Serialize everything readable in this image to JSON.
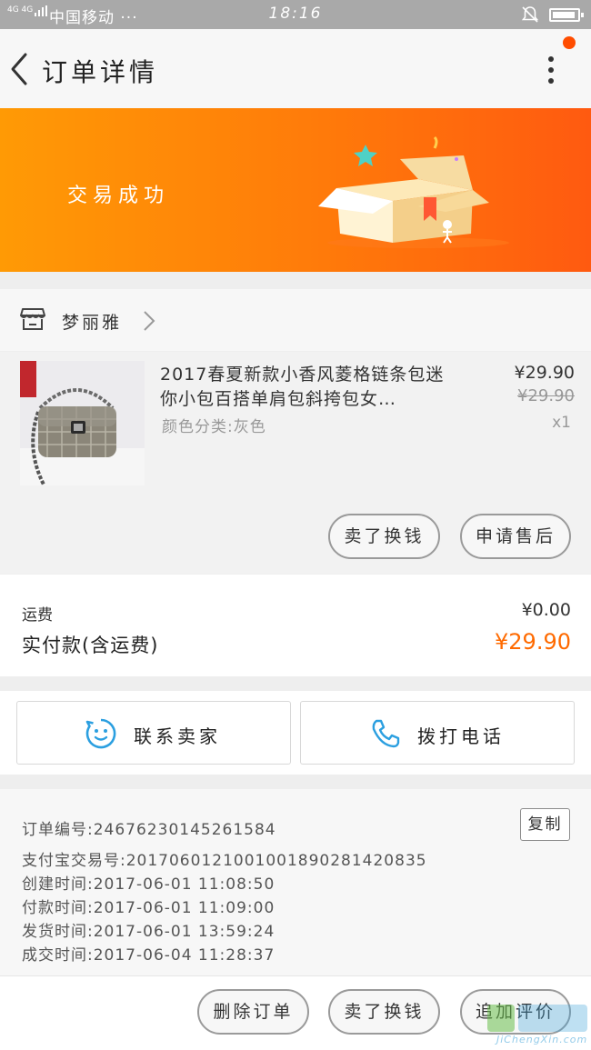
{
  "status_bar": {
    "signal": "4G 4G",
    "carrier": "中国移动 ···",
    "time": "18:16"
  },
  "header": {
    "title": "订单详情"
  },
  "banner": {
    "status": "交易成功"
  },
  "shop": {
    "name": "梦丽雅"
  },
  "item": {
    "title": "2017春夏新款小香风菱格链条包迷你小包百搭单肩包斜挎包女…",
    "variant": "颜色分类:灰色",
    "price": "¥29.90",
    "original_price": "¥29.90",
    "quantity": "x1",
    "buttons": [
      "卖了换钱",
      "申请售后"
    ]
  },
  "cost": {
    "shipping_label": "运费",
    "shipping_value": "¥0.00",
    "paid_label": "实付款(含运费)",
    "paid_value": "¥29.90"
  },
  "contact": {
    "seller_label": "联系卖家",
    "call_label": "拨打电话"
  },
  "order_info": {
    "order_no": "订单编号:2467623014526158​4",
    "copy_label": "复制",
    "alipay_no": "支付宝交易号:2017060121001001890281420835",
    "created": "创建时间:2017-06-01 11:08:50",
    "paid": "付款时间:2017-06-01 11:09:00",
    "shipped": "发货时间:2017-06-01 13:59:24",
    "completed": "成交时间:2017-06-04 11:28:37"
  },
  "footer": {
    "buttons": [
      "删除订单",
      "卖了换钱",
      "追加评价"
    ]
  },
  "watermark": {
    "text": "JiChengXin.com"
  },
  "colors": {
    "accent": "#ff6a00",
    "banner_start": "#ff9a05",
    "banner_end": "#ff5a10",
    "contact_icon": "#2b9fe0"
  }
}
